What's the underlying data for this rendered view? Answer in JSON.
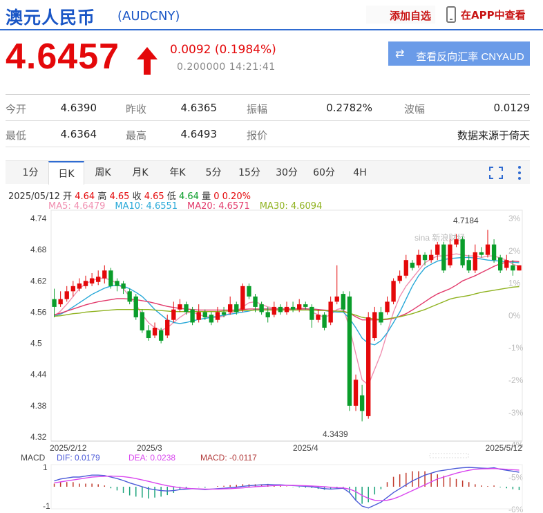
{
  "header": {
    "title": "澳元人民币",
    "code": "(AUDCNY)",
    "add_favorite": "添加自选",
    "view_in_app": "在APP中查看"
  },
  "quote": {
    "price": "4.6457",
    "change": "0.0092 (0.1984%)",
    "timestamp": "0.200000 14:21:41",
    "reverse_button": "查看反向汇率 CNYAUD"
  },
  "stats": {
    "open_label": "今开",
    "open": "4.6390",
    "prev_close_label": "昨收",
    "prev_close": "4.6365",
    "amplitude_label": "振幅",
    "amplitude": "0.2782%",
    "volatility_label": "波幅",
    "volatility": "0.0129",
    "low_label": "最低",
    "low": "4.6364",
    "high_label": "最高",
    "high": "4.6493",
    "quote_label": "报价",
    "source": "数据来源于倚天"
  },
  "tabs": [
    "1分",
    "日K",
    "周K",
    "月K",
    "年K",
    "5分",
    "15分",
    "30分",
    "60分",
    "4H"
  ],
  "active_tab": "日K",
  "info": {
    "date": "2025/05/12",
    "open_l": "开",
    "open_v": "4.64",
    "high_l": "高",
    "high_v": "4.65",
    "close_l": "收",
    "close_v": "4.65",
    "low_l": "低",
    "low_v": "4.64",
    "vol_l": "量",
    "vol_v": "0",
    "pct_v": "0.20%"
  },
  "ma_legend": [
    {
      "label": "MA5: 4.6479",
      "color": "#f08fb0"
    },
    {
      "label": "MA10: 4.6551",
      "color": "#27a8d8"
    },
    {
      "label": "MA20: 4.6571",
      "color": "#e23a6b"
    },
    {
      "label": "MA30: 4.6094",
      "color": "#8fb21f"
    }
  ],
  "macd_legend": {
    "macd_title": "MACD",
    "dif": "DIF: 0.0179",
    "dea": "DEA: 0.0238",
    "macd": "MACD: -0.0117"
  },
  "colors": {
    "up": "#e4080a",
    "down": "#0a9d2a",
    "brand": "#1a56c6",
    "button": "#6a9be8"
  },
  "chart_data": {
    "type": "candlestick",
    "y_ticks": [
      "4.74",
      "4.68",
      "4.62",
      "4.56",
      "4.5",
      "4.44",
      "4.38",
      "4.32"
    ],
    "pct_ticks": [
      "3%",
      "2%",
      "1%",
      "0%",
      "-1%",
      "-2%",
      "-3%",
      "-4%",
      "-5%",
      "-6%"
    ],
    "x_ticks": [
      "2025/2/12",
      "2025/3",
      "2025/4",
      "2025/5/12"
    ],
    "high_annotation": "4.7184",
    "low_annotation": "4.3439",
    "macd_ticks": [
      "1",
      "-1"
    ],
    "ylim": [
      4.32,
      4.74
    ],
    "candles": [
      [
        4.585,
        4.57,
        4.605,
        4.55
      ],
      [
        4.575,
        4.585,
        4.6,
        4.57
      ],
      [
        4.585,
        4.6,
        4.61,
        4.58
      ],
      [
        4.6,
        4.61,
        4.62,
        4.59
      ],
      [
        4.605,
        4.615,
        4.625,
        4.6
      ],
      [
        4.61,
        4.62,
        4.63,
        4.605
      ],
      [
        4.615,
        4.625,
        4.635,
        4.61
      ],
      [
        4.618,
        4.628,
        4.64,
        4.612
      ],
      [
        4.625,
        4.64,
        4.65,
        4.615
      ],
      [
        4.64,
        4.61,
        4.645,
        4.605
      ],
      [
        4.62,
        4.61,
        4.625,
        4.6
      ],
      [
        4.615,
        4.605,
        4.62,
        4.595
      ],
      [
        4.6,
        4.58,
        4.605,
        4.575
      ],
      [
        4.59,
        4.55,
        4.595,
        4.545
      ],
      [
        4.56,
        4.525,
        4.565,
        4.52
      ],
      [
        4.525,
        4.51,
        4.535,
        4.505
      ],
      [
        4.515,
        4.53,
        4.54,
        4.51
      ],
      [
        4.525,
        4.505,
        4.53,
        4.5
      ],
      [
        4.515,
        4.545,
        4.555,
        4.51
      ],
      [
        4.545,
        4.565,
        4.58,
        4.54
      ],
      [
        4.565,
        4.575,
        4.585,
        4.56
      ],
      [
        4.575,
        4.56,
        4.58,
        4.555
      ],
      [
        4.565,
        4.54,
        4.57,
        4.535
      ],
      [
        4.545,
        4.56,
        4.575,
        4.54
      ],
      [
        4.56,
        4.55,
        4.565,
        4.545
      ],
      [
        4.555,
        4.54,
        4.56,
        4.535
      ],
      [
        4.545,
        4.56,
        4.57,
        4.54
      ],
      [
        4.56,
        4.555,
        4.57,
        4.55
      ],
      [
        4.56,
        4.575,
        4.59,
        4.555
      ],
      [
        4.575,
        4.56,
        4.58,
        4.555
      ],
      [
        4.565,
        4.61,
        4.615,
        4.56
      ],
      [
        4.61,
        4.59,
        4.615,
        4.585
      ],
      [
        4.59,
        4.57,
        4.595,
        4.56
      ],
      [
        4.575,
        4.56,
        4.58,
        4.555
      ],
      [
        4.56,
        4.55,
        4.57,
        4.54
      ],
      [
        4.555,
        4.57,
        4.58,
        4.55
      ],
      [
        4.57,
        4.56,
        4.575,
        4.555
      ],
      [
        4.56,
        4.57,
        4.58,
        4.555
      ],
      [
        4.57,
        4.565,
        4.58,
        4.56
      ],
      [
        4.565,
        4.575,
        4.585,
        4.56
      ],
      [
        4.575,
        4.57,
        4.58,
        4.565
      ],
      [
        4.57,
        4.545,
        4.575,
        4.53
      ],
      [
        4.545,
        4.555,
        4.565,
        4.54
      ],
      [
        4.555,
        4.53,
        4.56,
        4.525
      ],
      [
        4.54,
        4.58,
        4.59,
        4.535
      ],
      [
        4.58,
        4.59,
        4.65,
        4.575
      ],
      [
        4.595,
        4.565,
        4.6,
        4.56
      ],
      [
        4.59,
        4.38,
        4.6,
        4.37
      ],
      [
        4.38,
        4.43,
        4.44,
        4.37
      ],
      [
        4.4,
        4.37,
        4.42,
        4.35
      ],
      [
        4.36,
        4.55,
        4.56,
        4.355
      ],
      [
        4.51,
        4.56,
        4.57,
        4.505
      ],
      [
        4.56,
        4.54,
        4.57,
        4.535
      ],
      [
        4.56,
        4.58,
        4.59,
        4.555
      ],
      [
        4.58,
        4.62,
        4.625,
        4.575
      ],
      [
        4.62,
        4.63,
        4.64,
        4.615
      ],
      [
        4.63,
        4.66,
        4.67,
        4.625
      ],
      [
        4.655,
        4.645,
        4.66,
        4.64
      ],
      [
        4.65,
        4.67,
        4.68,
        4.645
      ],
      [
        4.67,
        4.66,
        4.675,
        4.65
      ],
      [
        4.66,
        4.67,
        4.68,
        4.655
      ],
      [
        4.67,
        4.69,
        4.695,
        4.66
      ],
      [
        4.69,
        4.64,
        4.695,
        4.635
      ],
      [
        4.65,
        4.69,
        4.7,
        4.645
      ],
      [
        4.69,
        4.7,
        4.71,
        4.685
      ],
      [
        4.7,
        4.65,
        4.705,
        4.645
      ],
      [
        4.66,
        4.64,
        4.67,
        4.635
      ],
      [
        4.64,
        4.675,
        4.69,
        4.635
      ],
      [
        4.675,
        4.67,
        4.685,
        4.665
      ],
      [
        4.67,
        4.69,
        4.718,
        4.665
      ],
      [
        4.69,
        4.66,
        4.7,
        4.655
      ],
      [
        4.665,
        4.64,
        4.67,
        4.635
      ],
      [
        4.645,
        4.66,
        4.67,
        4.64
      ],
      [
        4.65,
        4.64,
        4.66,
        4.63
      ],
      [
        4.64,
        4.65,
        4.65,
        4.64
      ]
    ],
    "series": [
      {
        "name": "MA5",
        "values": [
          4.552,
          4.562,
          4.575,
          4.59,
          4.605,
          4.615,
          4.62,
          4.625,
          4.625,
          4.622,
          4.615,
          4.605,
          4.59,
          4.575,
          4.555,
          4.54,
          4.53,
          4.525,
          4.53,
          4.54,
          4.55,
          4.558,
          4.56,
          4.555,
          4.552,
          4.55,
          4.55,
          4.552,
          4.558,
          4.562,
          4.57,
          4.578,
          4.58,
          4.575,
          4.57,
          4.568,
          4.565,
          4.565,
          4.566,
          4.567,
          4.568,
          4.56,
          4.555,
          4.55,
          4.555,
          4.565,
          4.568,
          4.53,
          4.48,
          4.43,
          4.42,
          4.45,
          4.48,
          4.52,
          4.56,
          4.59,
          4.61,
          4.625,
          4.64,
          4.655,
          4.662,
          4.668,
          4.668,
          4.67,
          4.672,
          4.67,
          4.668,
          4.668,
          4.665,
          4.668,
          4.668,
          4.664,
          4.66,
          4.652,
          4.648
        ]
      },
      {
        "name": "MA10",
        "values": [
          4.552,
          4.556,
          4.562,
          4.57,
          4.578,
          4.586,
          4.594,
          4.6,
          4.606,
          4.61,
          4.612,
          4.61,
          4.605,
          4.598,
          4.59,
          4.578,
          4.565,
          4.555,
          4.545,
          4.54,
          4.538,
          4.54,
          4.543,
          4.546,
          4.548,
          4.55,
          4.552,
          4.554,
          4.556,
          4.558,
          4.56,
          4.562,
          4.565,
          4.566,
          4.566,
          4.566,
          4.566,
          4.566,
          4.566,
          4.566,
          4.566,
          4.566,
          4.565,
          4.563,
          4.561,
          4.56,
          4.56,
          4.548,
          4.53,
          4.51,
          4.5,
          4.497,
          4.505,
          4.52,
          4.54,
          4.56,
          4.585,
          4.61,
          4.63,
          4.645,
          4.652,
          4.658,
          4.661,
          4.663,
          4.664,
          4.665,
          4.665,
          4.664,
          4.662,
          4.66,
          4.659,
          4.658,
          4.657,
          4.656,
          4.655
        ]
      },
      {
        "name": "MA20",
        "values": [
          4.555,
          4.558,
          4.562,
          4.566,
          4.57,
          4.574,
          4.577,
          4.58,
          4.582,
          4.584,
          4.586,
          4.586,
          4.585,
          4.584,
          4.582,
          4.58,
          4.577,
          4.574,
          4.571,
          4.569,
          4.567,
          4.566,
          4.565,
          4.564,
          4.564,
          4.564,
          4.564,
          4.564,
          4.564,
          4.564,
          4.565,
          4.566,
          4.566,
          4.566,
          4.566,
          4.566,
          4.566,
          4.566,
          4.566,
          4.566,
          4.566,
          4.566,
          4.565,
          4.564,
          4.563,
          4.562,
          4.562,
          4.558,
          4.551,
          4.545,
          4.545,
          4.545,
          4.545,
          4.546,
          4.548,
          4.552,
          4.557,
          4.564,
          4.572,
          4.58,
          4.588,
          4.595,
          4.6,
          4.605,
          4.612,
          4.62,
          4.625,
          4.63,
          4.636,
          4.642,
          4.648,
          4.653,
          4.656,
          4.658,
          4.657
        ]
      },
      {
        "name": "MA30",
        "values": [
          4.552,
          4.553,
          4.555,
          4.557,
          4.558,
          4.56,
          4.561,
          4.562,
          4.563,
          4.564,
          4.565,
          4.565,
          4.565,
          4.565,
          4.565,
          4.565,
          4.564,
          4.563,
          4.562,
          4.561,
          4.561,
          4.561,
          4.561,
          4.561,
          4.561,
          4.561,
          4.561,
          4.562,
          4.562,
          4.562,
          4.563,
          4.563,
          4.564,
          4.564,
          4.564,
          4.564,
          4.564,
          4.564,
          4.564,
          4.564,
          4.564,
          4.564,
          4.563,
          4.563,
          4.562,
          4.562,
          4.561,
          4.558,
          4.554,
          4.55,
          4.548,
          4.547,
          4.546,
          4.547,
          4.549,
          4.551,
          4.554,
          4.557,
          4.561,
          4.565,
          4.57,
          4.575,
          4.58,
          4.585,
          4.588,
          4.59,
          4.592,
          4.595,
          4.598,
          4.6,
          4.602,
          4.604,
          4.606,
          4.608,
          4.609
        ]
      }
    ],
    "macd": {
      "dif": [
        0.3,
        0.4,
        0.45,
        0.5,
        0.5,
        0.55,
        0.6,
        0.6,
        0.58,
        0.5,
        0.42,
        0.32,
        0.2,
        0.1,
        0.0,
        -0.1,
        -0.15,
        -0.2,
        -0.22,
        -0.2,
        -0.15,
        -0.12,
        -0.1,
        -0.12,
        -0.15,
        -0.12,
        -0.1,
        -0.08,
        -0.05,
        -0.02,
        0.02,
        0.05,
        0.08,
        0.1,
        0.12,
        0.1,
        0.1,
        0.08,
        0.06,
        0.04,
        0.02,
        0.0,
        -0.05,
        -0.1,
        -0.12,
        -0.1,
        -0.08,
        -0.3,
        -0.7,
        -1.0,
        -1.1,
        -0.95,
        -0.8,
        -0.55,
        -0.3,
        -0.1,
        0.1,
        0.3,
        0.45,
        0.6,
        0.7,
        0.8,
        0.85,
        0.9,
        0.95,
        0.98,
        1.0,
        0.98,
        0.96,
        0.95,
        0.98,
        0.9,
        0.85,
        0.8,
        0.75
      ],
      "dea": [
        0.2,
        0.25,
        0.3,
        0.35,
        0.4,
        0.45,
        0.5,
        0.52,
        0.54,
        0.55,
        0.54,
        0.52,
        0.48,
        0.42,
        0.35,
        0.28,
        0.2,
        0.12,
        0.05,
        0.0,
        -0.05,
        -0.08,
        -0.1,
        -0.11,
        -0.12,
        -0.12,
        -0.12,
        -0.11,
        -0.1,
        -0.08,
        -0.06,
        -0.03,
        0.0,
        0.02,
        0.04,
        0.06,
        0.07,
        0.07,
        0.07,
        0.06,
        0.05,
        0.04,
        0.02,
        0.0,
        -0.03,
        -0.05,
        -0.06,
        -0.12,
        -0.25,
        -0.45,
        -0.6,
        -0.7,
        -0.72,
        -0.7,
        -0.62,
        -0.5,
        -0.35,
        -0.2,
        -0.05,
        0.1,
        0.25,
        0.4,
        0.5,
        0.6,
        0.7,
        0.78,
        0.85,
        0.9,
        0.92,
        0.93,
        0.94,
        0.92,
        0.9,
        0.88,
        0.86
      ]
    }
  }
}
